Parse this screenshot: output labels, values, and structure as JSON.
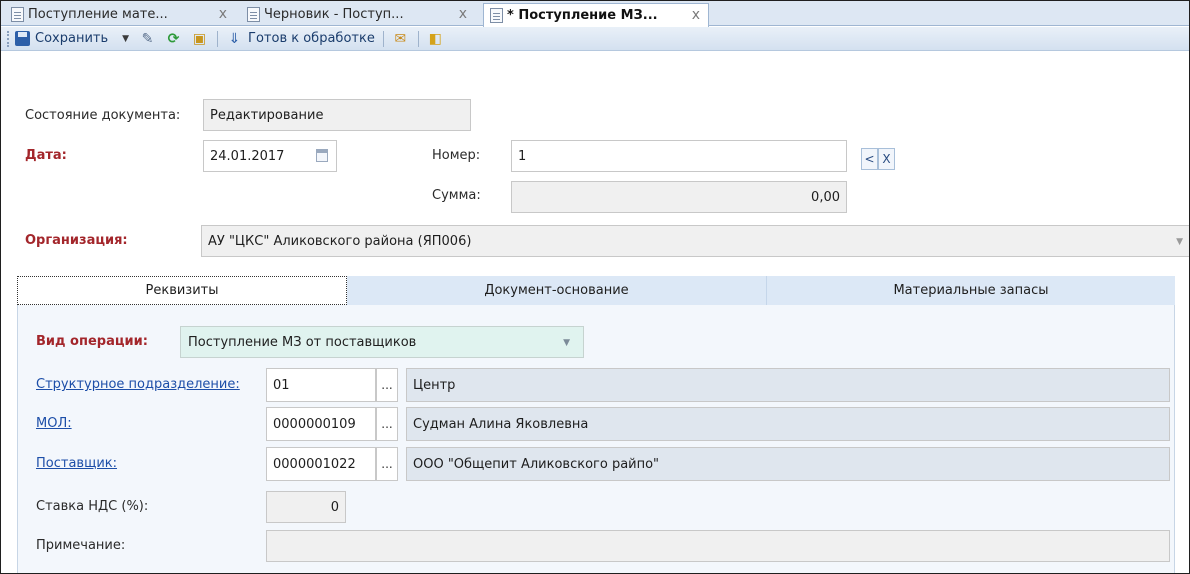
{
  "tabs": [
    {
      "label": "Поступление мате...",
      "close": "x",
      "active": false
    },
    {
      "label": "Черновик - Поступ...",
      "close": "x",
      "active": false
    },
    {
      "label": "* Поступление МЗ...",
      "close": "x",
      "active": true
    }
  ],
  "toolbar": {
    "save_label": "Сохранить",
    "ready_label": "Готов к обработке",
    "icons": [
      "save-icon",
      "dropdown-arrow-icon",
      "edit-icon",
      "refresh-icon",
      "copy-icon",
      "arrow-down-icon",
      "mail-icon",
      "exit-icon"
    ]
  },
  "header": {
    "state_label": "Состояние документа:",
    "state_value": "Редактирование",
    "date_label": "Дата:",
    "date_value": "24.01.2017",
    "number_label": "Номер:",
    "number_value": "1",
    "prev_btn": "<",
    "clear_btn": "X",
    "sum_label": "Сумма:",
    "sum_value": "0,00",
    "org_label": "Организация:",
    "org_value": "АУ \"ЦКС\" Аликовского района (ЯП006)"
  },
  "lower_tabs": [
    "Реквизиты",
    "Документ-основание",
    "Материальные запасы"
  ],
  "requisites": {
    "op_label": "Вид операции:",
    "op_value": "Поступление МЗ от поставщиков",
    "rows": [
      {
        "label": "Структурное подразделение:",
        "code": "01",
        "name": "Центр"
      },
      {
        "label": "МОЛ:",
        "code": "0000000109",
        "name": "Судман Алина Яковлевна"
      },
      {
        "label": "Поставщик:",
        "code": "0000001022",
        "name": "ООО \"Общепит Аликовского райпо\""
      }
    ],
    "ellipsis": "...",
    "vat_label": "Ставка НДС (%):",
    "vat_value": "0",
    "note_label": "Примечание:",
    "note_value": ""
  },
  "colors": {
    "accent": "#a3262b",
    "link": "#1c4ea8",
    "tab_bg": "#dce8f6"
  }
}
